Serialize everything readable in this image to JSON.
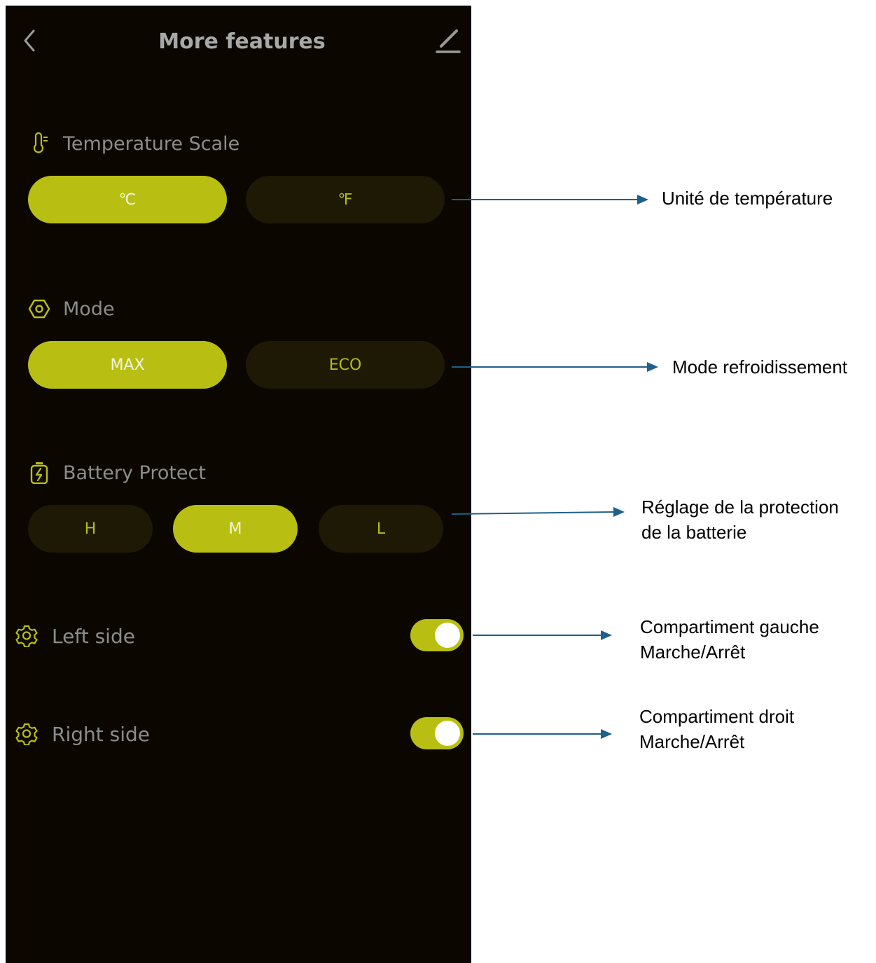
{
  "header": {
    "title": "More features"
  },
  "temperature": {
    "label": "Temperature Scale",
    "options": [
      "℃",
      "℉"
    ],
    "selected": "℃"
  },
  "mode": {
    "label": "Mode",
    "options": [
      "MAX",
      "ECO"
    ],
    "selected": "MAX"
  },
  "battery": {
    "label": "Battery Protect",
    "options": [
      "H",
      "M",
      "L"
    ],
    "selected": "M"
  },
  "left_side": {
    "label": "Left side",
    "on": true
  },
  "right_side": {
    "label": "Right side",
    "on": true
  },
  "annotations": {
    "temperature": "Unité de température",
    "mode": "Mode refroidissement",
    "battery_line1": "Réglage de la protection",
    "battery_line2": "de la batterie",
    "left_line1": "Compartiment gauche",
    "left_line2": "Marche/Arrêt",
    "right_line1": "Compartiment droit",
    "right_line2": "Marche/Arrêt"
  },
  "colors": {
    "background": "#0b0700",
    "accent": "#b9bf12",
    "inactive_button": "#1d1905",
    "label": "#8c8c8c",
    "arrow": "#1f5f8b"
  },
  "icons": [
    "chevron-left-icon",
    "edit-pencil-icon",
    "thermometer-icon",
    "hexagon-mode-icon",
    "battery-icon",
    "gear-icon"
  ]
}
